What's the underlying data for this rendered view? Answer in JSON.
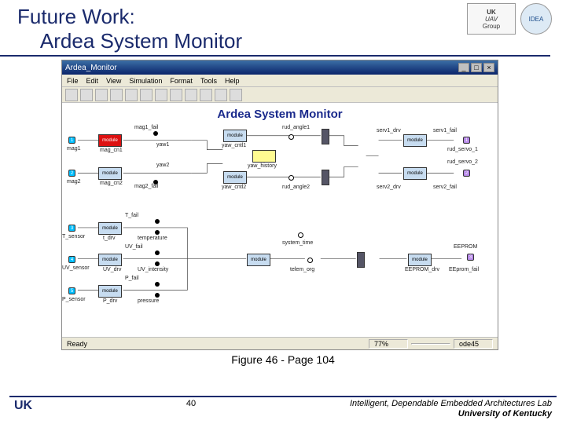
{
  "slide": {
    "title_line1": "Future Work:",
    "title_line2": "Ardea System Monitor",
    "caption": "Figure 46 - Page 104",
    "page_number": "40",
    "lab_line1": "Intelligent, Dependable Embedded Architectures Lab",
    "lab_line2": "University of Kentucky",
    "logo_uk": "UK",
    "logo_uav_top": "UK",
    "logo_uav_mid": "UAV",
    "logo_uav_bot": "Group",
    "logo_idea": "IDEA"
  },
  "window": {
    "title": "Ardea_Monitor",
    "min": "_",
    "max": "□",
    "close": "×",
    "menu": [
      "File",
      "Edit",
      "View",
      "Simulation",
      "Format",
      "Tools",
      "Help"
    ],
    "status_ready": "Ready",
    "status_zoom": "77%",
    "status_solver": "ode45"
  },
  "diagram": {
    "canvas_title": "Ardea System Monitor",
    "labels": {
      "mag1_fail": "mag1_fail",
      "mag_cn1": "mag_cn1",
      "yaw1": "yaw1",
      "yaw2": "yaw2",
      "mag2": "mag2",
      "mag_cn2": "mag_cn2",
      "mag2_fail": "mag2_fail",
      "module": "module",
      "rud_angle1": "rud_angle1",
      "yaw_cntl1": "yaw_cntl1",
      "yaw_history": "yaw_history",
      "yaw_cntl2": "yaw_cntl2",
      "rud_angle2": "rud_angle2",
      "serv1_drv": "serv1_drv",
      "serv2_drv": "serv2_drv",
      "serv1_fail": "serv1_fail",
      "serv2_fail": "serv2_fail",
      "rud_servo_1": "rud_servo_1",
      "rud_servo_2": "rud_servo_2",
      "T_fail": "T_fail",
      "T_sensor": "T_sensor",
      "t_drv": "t_drv",
      "temperature": "temperature",
      "UV_fail": "UV_fail",
      "UV_sensor": "UV_sensor",
      "UV_drv": "UV_drv",
      "UV_intensity": "UV_intensity",
      "P_fail": "P_fail",
      "P_sensor": "P_sensor",
      "P_drv": "P_drv",
      "pressure": "pressure",
      "system_time": "system_time",
      "telem_org": "telem_org",
      "EEPROM": "EEPROM",
      "EEPROM_drv": "EEPROM_drv",
      "EEprom_fail": "EEprom_fail"
    },
    "port_numbers": {
      "p1": "1",
      "p2": "2",
      "p3": "3",
      "p4": "4",
      "p5": "5",
      "out1": "1",
      "out2": "2"
    }
  }
}
